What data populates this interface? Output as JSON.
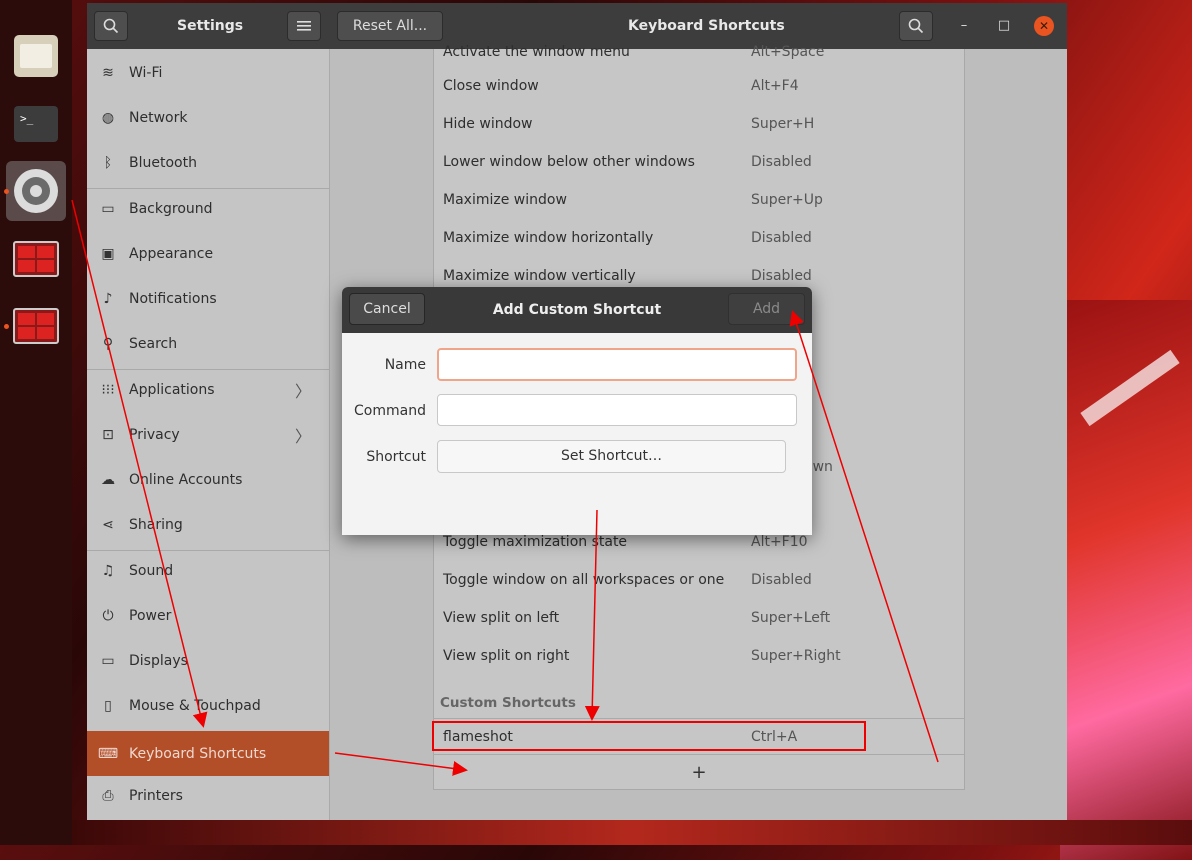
{
  "dock": {
    "items": [
      {
        "icon": "files-icon"
      },
      {
        "icon": "terminal-icon",
        "glyph": ">_"
      },
      {
        "icon": "settings-icon"
      },
      {
        "icon": "app-icon"
      },
      {
        "icon": "app-icon"
      }
    ]
  },
  "window": {
    "sidebar_title": "Settings",
    "reset_label": "Reset All...",
    "title": "Keyboard Shortcuts",
    "minimize": "–",
    "maximize": "□",
    "close": "✕"
  },
  "sidebar": {
    "items": [
      {
        "label": "Wi-Fi",
        "icon": "wifi-icon"
      },
      {
        "label": "Network",
        "icon": "network-icon"
      },
      {
        "label": "Bluetooth",
        "icon": "bluetooth-icon"
      },
      {
        "label": "Background",
        "icon": "background-icon"
      },
      {
        "label": "Appearance",
        "icon": "appearance-icon"
      },
      {
        "label": "Notifications",
        "icon": "notifications-icon"
      },
      {
        "label": "Search",
        "icon": "search-icon"
      },
      {
        "label": "Applications",
        "icon": "applications-icon"
      },
      {
        "label": "Privacy",
        "icon": "privacy-icon"
      },
      {
        "label": "Online Accounts",
        "icon": "cloud-icon"
      },
      {
        "label": "Sharing",
        "icon": "sharing-icon"
      },
      {
        "label": "Sound",
        "icon": "music-note-icon"
      },
      {
        "label": "Power",
        "icon": "power-icon"
      },
      {
        "label": "Displays",
        "icon": "display-icon"
      },
      {
        "label": "Mouse & Touchpad",
        "icon": "mouse-icon"
      },
      {
        "label": "Keyboard Shortcuts",
        "icon": "keyboard-icon"
      },
      {
        "label": "Printers",
        "icon": "printer-icon"
      }
    ]
  },
  "shortcuts": [
    {
      "name": "Close window",
      "key": "Alt+F4"
    },
    {
      "name": "Hide window",
      "key": "Super+H"
    },
    {
      "name": "Lower window below other windows",
      "key": "Disabled"
    },
    {
      "name": "Maximize window",
      "key": "Super+Up"
    },
    {
      "name": "Maximize window horizontally",
      "key": "Disabled"
    },
    {
      "name": "Maximize window vertically",
      "key": "Disabled"
    },
    {
      "name": "Toggle maximization state",
      "key": "Alt+F10"
    },
    {
      "name": "Toggle window on all workspaces or one",
      "key": "Disabled"
    },
    {
      "name": "View split on left",
      "key": "Super+Left"
    },
    {
      "name": "View split on right",
      "key": "Super+Right"
    }
  ],
  "partial_top": {
    "name": "Activate the window menu",
    "key": "Alt+Space"
  },
  "partial_behind": "own",
  "custom": {
    "heading": "Custom Shortcuts",
    "items": [
      {
        "name": "flameshot",
        "key": "Ctrl+A"
      }
    ],
    "add_symbol": "+"
  },
  "dialog": {
    "title": "Add Custom Shortcut",
    "cancel": "Cancel",
    "add": "Add",
    "name_label": "Name",
    "command_label": "Command",
    "shortcut_label": "Shortcut",
    "name_value": "",
    "command_value": "",
    "set_shortcut": "Set Shortcut…"
  },
  "colors": {
    "accent": "#e95420",
    "selected": "#b24e28",
    "annotation": "#e00000"
  }
}
